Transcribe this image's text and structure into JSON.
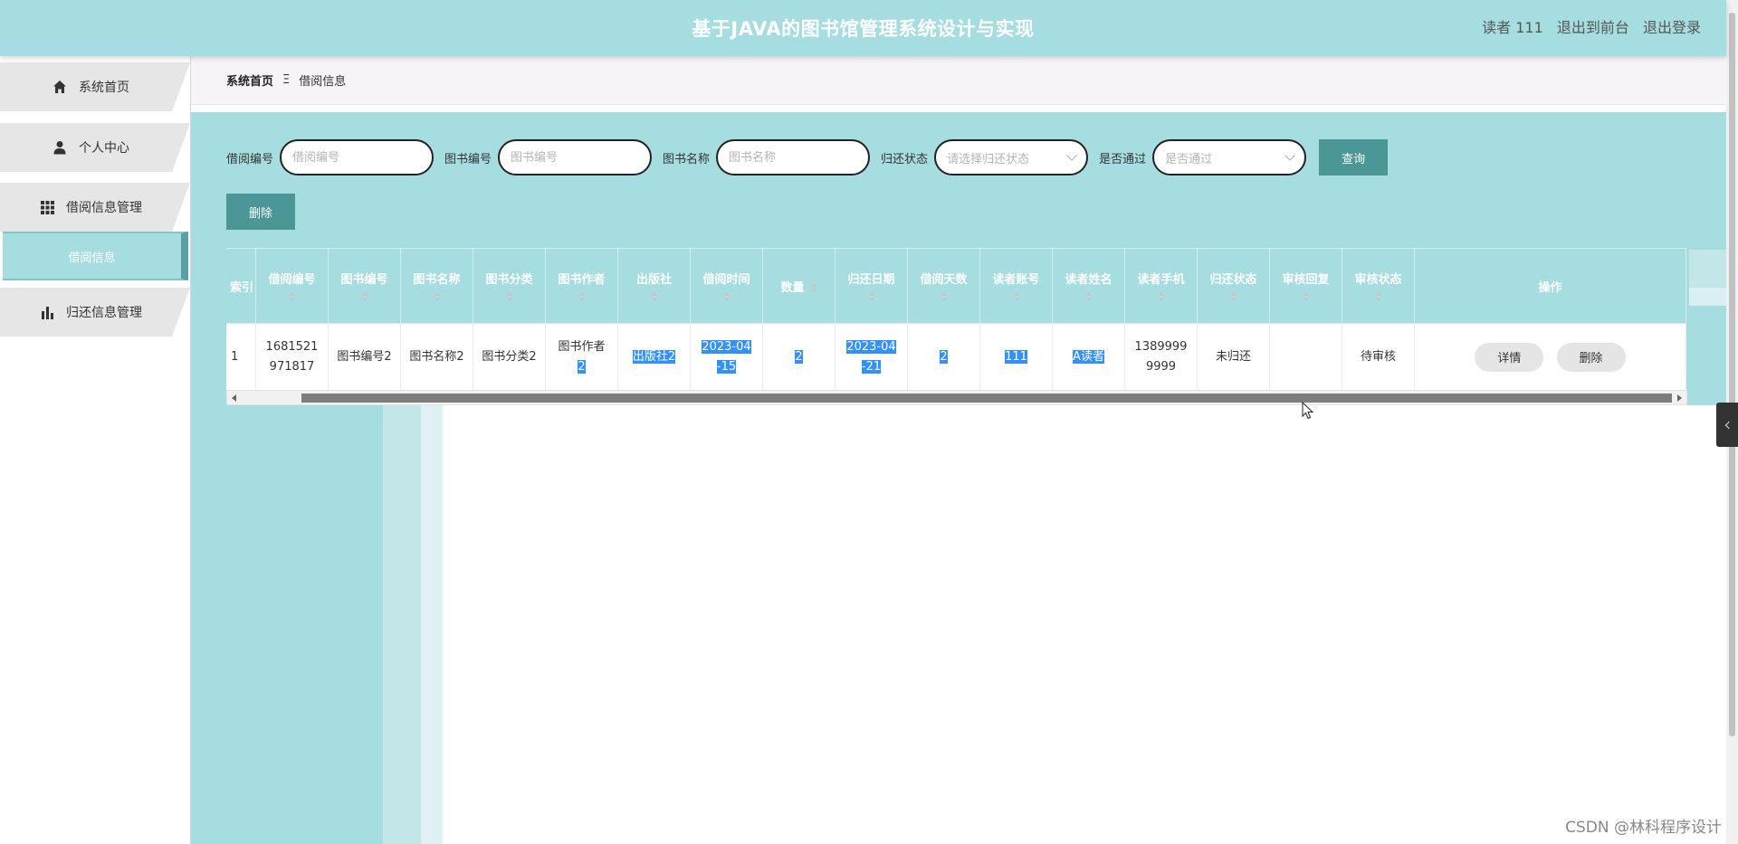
{
  "header": {
    "title": "基于JAVA的图书馆管理系统设计与实现",
    "user": "读者 111",
    "front_link": "退出到前台",
    "logout_link": "退出登录"
  },
  "sidebar": {
    "items": [
      {
        "label": "系统首页",
        "icon": "home-icon"
      },
      {
        "label": "个人中心",
        "icon": "person-icon"
      },
      {
        "label": "借阅信息管理",
        "icon": "grid-icon"
      },
      {
        "label": "借阅信息",
        "icon": ""
      },
      {
        "label": "归还信息管理",
        "icon": "bar-chart-icon"
      }
    ]
  },
  "breadcrumb": {
    "home": "系统首页",
    "sep": "Ξ",
    "current": "借阅信息"
  },
  "search": {
    "f1_label": "借阅编号",
    "f1_placeholder": "借阅编号",
    "f2_label": "图书编号",
    "f2_placeholder": "图书编号",
    "f3_label": "图书名称",
    "f3_placeholder": "图书名称",
    "f4_label": "归还状态",
    "f4_placeholder": "请选择归还状态",
    "f5_label": "是否通过",
    "f5_placeholder": "是否通过",
    "query_label": "查询"
  },
  "toolbar": {
    "delete_label": "删除"
  },
  "table": {
    "headers": [
      "索引",
      "借阅编号",
      "图书编号",
      "图书名称",
      "图书分类",
      "图书作者",
      "出版社",
      "借阅时间",
      "数量",
      "归还日期",
      "借阅天数",
      "读者账号",
      "读者姓名",
      "读者手机",
      "归还状态",
      "审核回复",
      "审核状态",
      "操作"
    ],
    "row": {
      "index": "1",
      "borrow_no": "1681521971817",
      "book_no": "图书编号2",
      "book_name": "图书名称2",
      "book_cat": "图书分类2",
      "book_author_a": "图书作者",
      "book_author_b": "2",
      "publisher": "出版社2",
      "borrow_time_a": "2023-04",
      "borrow_time_b": "-15",
      "qty": "2",
      "return_date_a": "2023-04",
      "return_date_b": "-21",
      "days": "2",
      "account": "111",
      "reader_name": "A读者",
      "phone": "13899999999",
      "return_status": "未归还",
      "review_reply": "",
      "review_status": "待审核",
      "detail_label": "详情",
      "delete_label": "删除"
    }
  },
  "watermark": "CSDN @林科程序设计"
}
